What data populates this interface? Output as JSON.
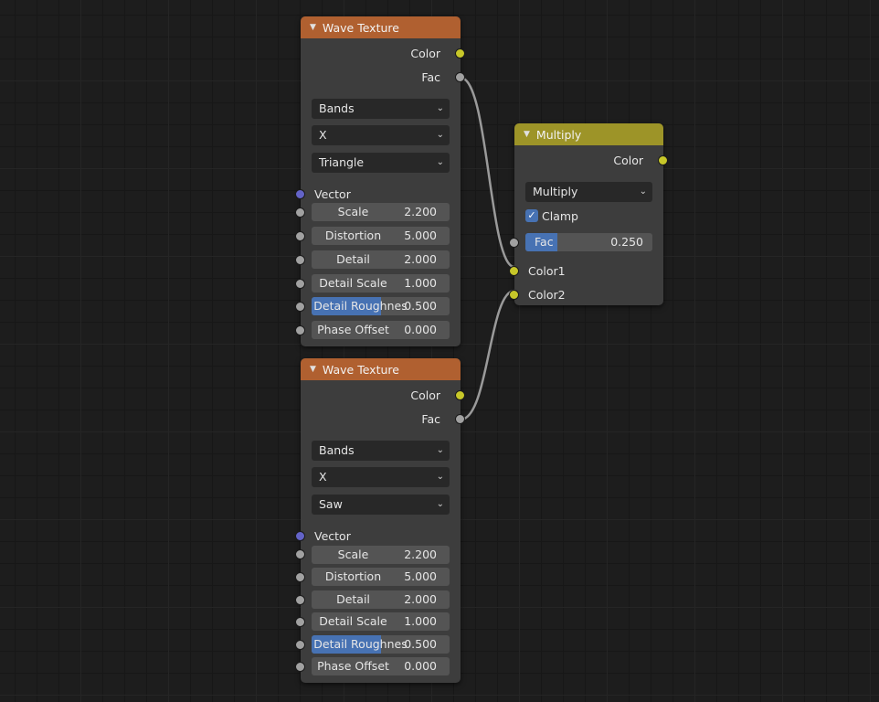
{
  "nodes": {
    "wave1": {
      "title": "Wave Texture",
      "outputs": {
        "color": "Color",
        "fac": "Fac"
      },
      "wave_type": "Bands",
      "direction": "X",
      "profile": "Triangle",
      "vector_label": "Vector",
      "fields": [
        {
          "label": "Scale",
          "value": "2.200",
          "fill_fraction": 0
        },
        {
          "label": "Distortion",
          "value": "5.000",
          "fill_fraction": 0
        },
        {
          "label": "Detail",
          "value": "2.000",
          "fill_fraction": 0
        },
        {
          "label": "Detail Scale",
          "value": "1.000",
          "fill_fraction": 0
        },
        {
          "label": "Detail Roughnes",
          "value": "0.500",
          "fill_fraction": 0.5
        },
        {
          "label": "Phase Offset",
          "value": "0.000",
          "fill_fraction": 0
        }
      ]
    },
    "wave2": {
      "title": "Wave Texture",
      "outputs": {
        "color": "Color",
        "fac": "Fac"
      },
      "wave_type": "Bands",
      "direction": "X",
      "profile": "Saw",
      "vector_label": "Vector",
      "fields": [
        {
          "label": "Scale",
          "value": "2.200",
          "fill_fraction": 0
        },
        {
          "label": "Distortion",
          "value": "5.000",
          "fill_fraction": 0
        },
        {
          "label": "Detail",
          "value": "2.000",
          "fill_fraction": 0
        },
        {
          "label": "Detail Scale",
          "value": "1.000",
          "fill_fraction": 0
        },
        {
          "label": "Detail Roughnes",
          "value": "0.500",
          "fill_fraction": 0.5
        },
        {
          "label": "Phase Offset",
          "value": "0.000",
          "fill_fraction": 0
        }
      ]
    },
    "multiply": {
      "title": "Multiply",
      "output": "Color",
      "blend_mode": "Multiply",
      "clamp_label": "Clamp",
      "clamp_checked": true,
      "fac": {
        "label": "Fac",
        "value": "0.250",
        "fill_fraction": 0.25
      },
      "inputs": {
        "color1": "Color1",
        "color2": "Color2"
      }
    }
  },
  "colors": {
    "texture_header": "#b06030",
    "color_header": "#9d9428",
    "socket_color": "#c7c729",
    "socket_float": "#a1a1a1",
    "socket_vector": "#6363c7",
    "slider_fill": "#4772b3"
  },
  "icons": {
    "collapse": "triangle-down-icon",
    "dropdown": "chevron-down-icon",
    "check": "checkmark-icon"
  }
}
